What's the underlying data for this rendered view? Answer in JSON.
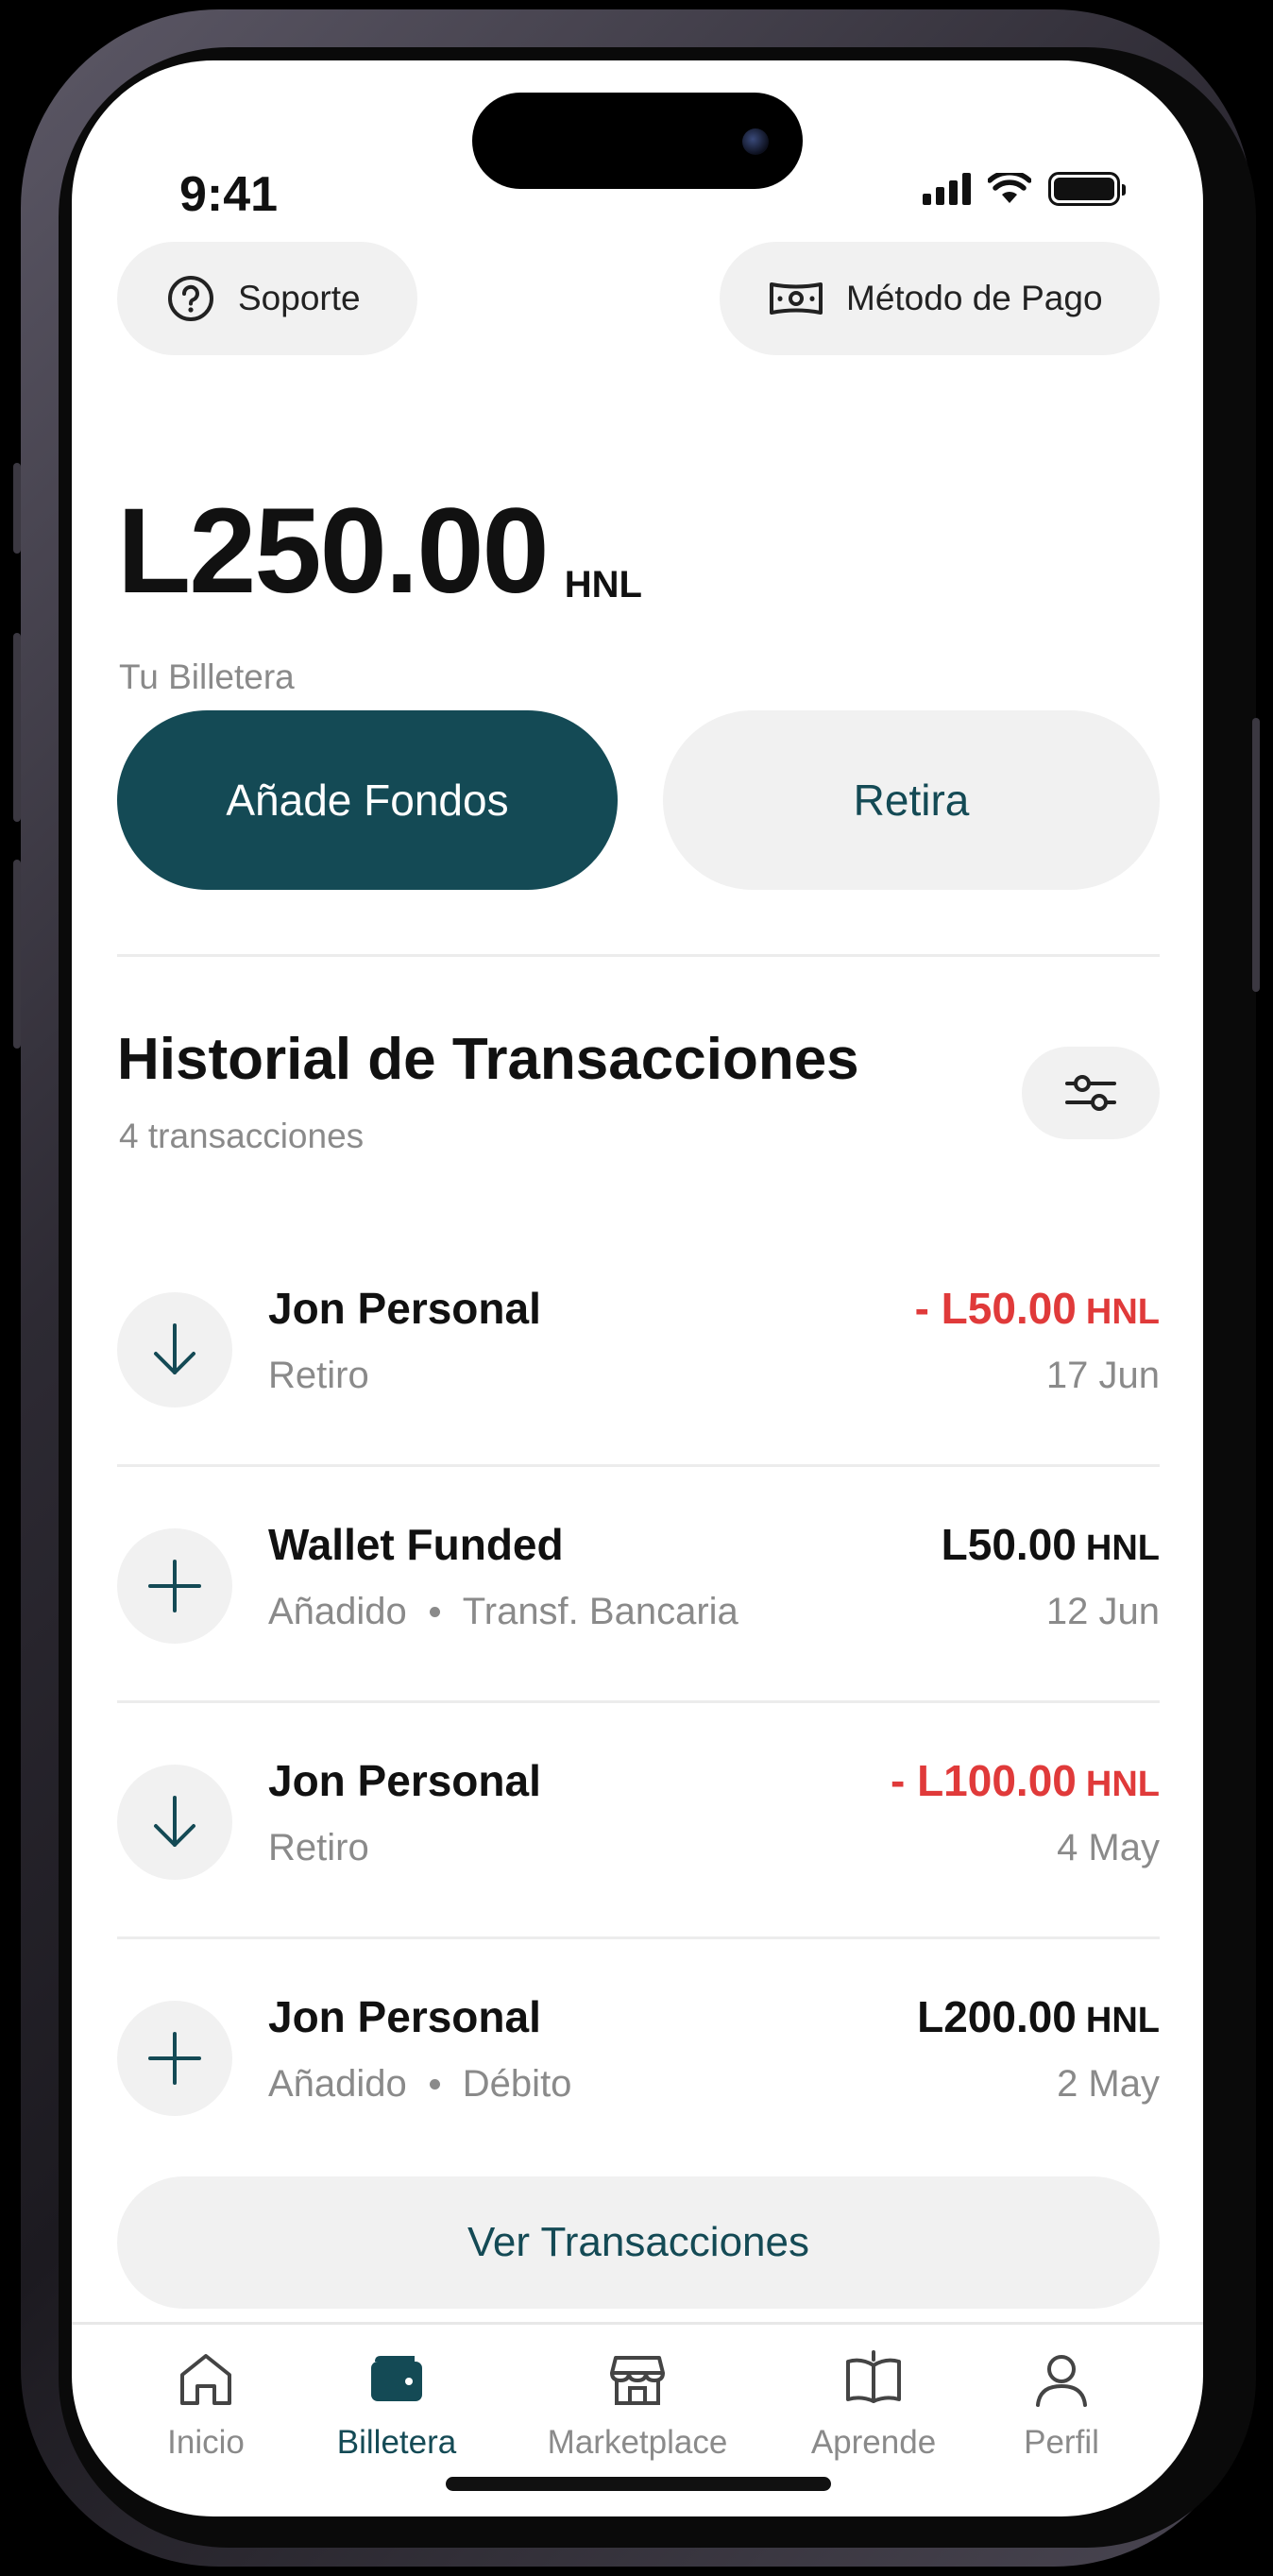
{
  "status_bar": {
    "time": "9:41"
  },
  "top_actions": {
    "support_label": "Soporte",
    "payment_method_label": "Método de Pago"
  },
  "balance": {
    "amount": "L250.00",
    "currency": "HNL",
    "label": "Tu Billetera"
  },
  "actions": {
    "add_funds_label": "Añade Fondos",
    "withdraw_label": "Retira"
  },
  "history": {
    "title": "Historial de Transacciones",
    "count": "4 transacciones",
    "transactions": [
      {
        "name": "Jon Personal",
        "type": "Retiro",
        "method": "",
        "amount": "- L50.00",
        "currency": "HNL",
        "date": "17 Jun",
        "direction": "out"
      },
      {
        "name": "Wallet Funded",
        "type": "Añadido",
        "method": "Transf. Bancaria",
        "amount": "L50.00",
        "currency": "HNL",
        "date": "12 Jun",
        "direction": "in"
      },
      {
        "name": "Jon Personal",
        "type": "Retiro",
        "method": "",
        "amount": "- L100.00",
        "currency": "HNL",
        "date": "4 May",
        "direction": "out"
      },
      {
        "name": "Jon Personal",
        "type": "Añadido",
        "method": "Débito",
        "amount": "L200.00",
        "currency": "HNL",
        "date": "2 May",
        "direction": "in"
      }
    ],
    "view_all_label": "Ver Transacciones"
  },
  "nav": {
    "items": [
      {
        "label": "Inicio",
        "icon": "home-icon",
        "active": false
      },
      {
        "label": "Billetera",
        "icon": "wallet-icon",
        "active": true
      },
      {
        "label": "Marketplace",
        "icon": "store-icon",
        "active": false
      },
      {
        "label": "Aprende",
        "icon": "book-icon",
        "active": false
      },
      {
        "label": "Perfil",
        "icon": "user-icon",
        "active": false
      }
    ]
  },
  "colors": {
    "primary": "#144a55",
    "negative": "#e03a3a",
    "muted": "#8a8a8a",
    "surface": "#f1f1f1"
  }
}
